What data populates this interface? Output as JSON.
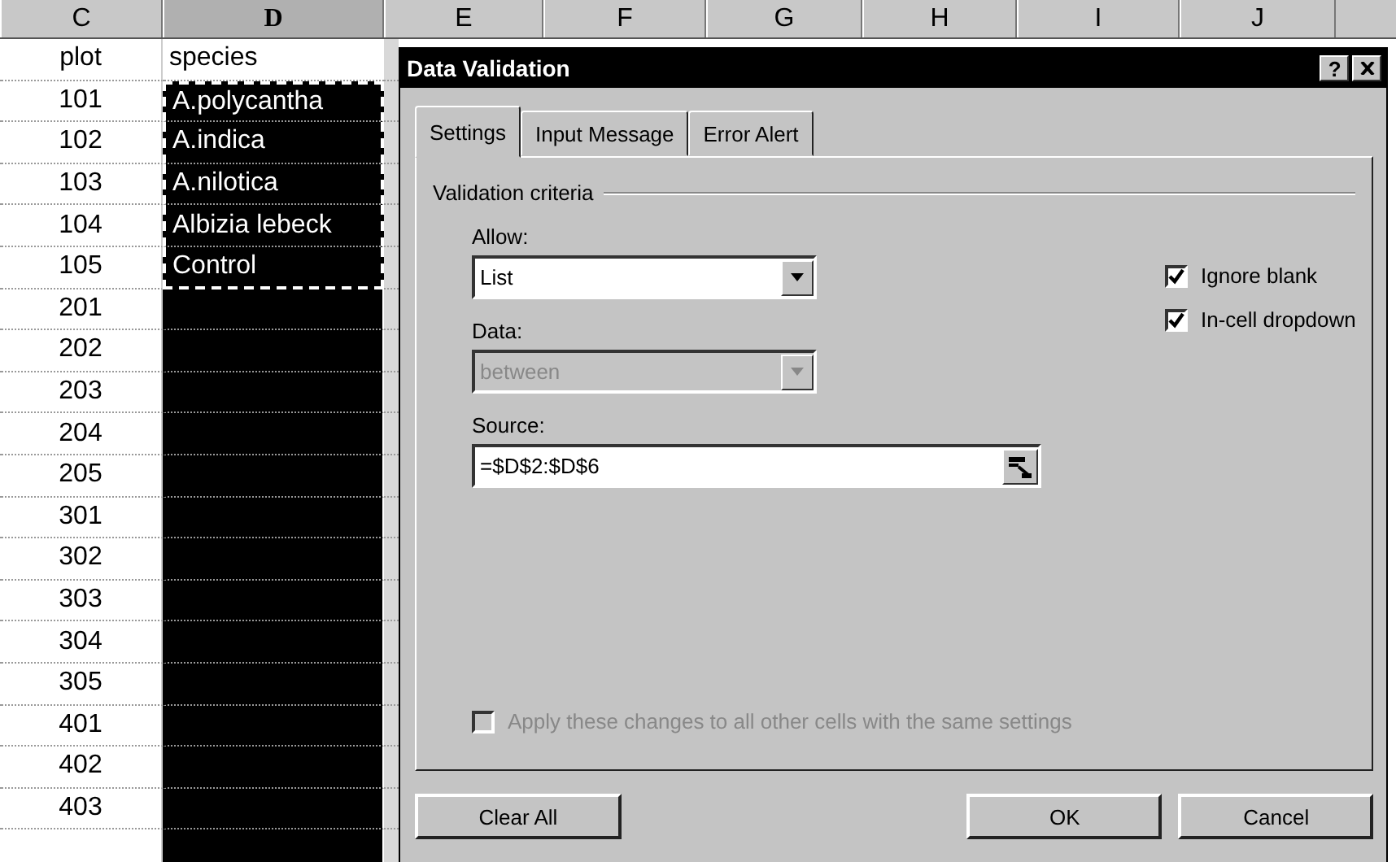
{
  "columns": [
    {
      "label": "C",
      "selected": false
    },
    {
      "label": "D",
      "selected": true
    },
    {
      "label": "E",
      "selected": false
    },
    {
      "label": "F",
      "selected": false
    },
    {
      "label": "G",
      "selected": false
    },
    {
      "label": "H",
      "selected": false
    },
    {
      "label": "I",
      "selected": false
    },
    {
      "label": "J",
      "selected": false
    }
  ],
  "rows": [
    {
      "plot": "plot",
      "species": "species",
      "selected": false,
      "marquee": false
    },
    {
      "plot": "101",
      "species": "A.polycantha",
      "selected": true,
      "marquee": true
    },
    {
      "plot": "102",
      "species": "A.indica",
      "selected": true,
      "marquee": true
    },
    {
      "plot": "103",
      "species": "A.nilotica",
      "selected": true,
      "marquee": true
    },
    {
      "plot": "104",
      "species": "Albizia lebeck",
      "selected": true,
      "marquee": true
    },
    {
      "plot": "105",
      "species": "Control",
      "selected": true,
      "marquee": true
    },
    {
      "plot": "201",
      "selected": true,
      "marquee": false
    },
    {
      "plot": "202",
      "selected": true,
      "marquee": false
    },
    {
      "plot": "203",
      "selected": true,
      "marquee": false
    },
    {
      "plot": "204",
      "selected": true,
      "marquee": false
    },
    {
      "plot": "205",
      "selected": true,
      "marquee": false
    },
    {
      "plot": "301",
      "selected": true,
      "marquee": false
    },
    {
      "plot": "302",
      "selected": true,
      "marquee": false
    },
    {
      "plot": "303",
      "selected": true,
      "marquee": false
    },
    {
      "plot": "304",
      "selected": true,
      "marquee": false
    },
    {
      "plot": "305",
      "selected": true,
      "marquee": false
    },
    {
      "plot": "401",
      "selected": true,
      "marquee": false
    },
    {
      "plot": "402",
      "selected": true,
      "marquee": false
    },
    {
      "plot": "403",
      "selected": true,
      "marquee": false
    }
  ],
  "dialog": {
    "title": "Data Validation",
    "help_button": "?",
    "tabs": [
      {
        "label": "Settings",
        "selected": true
      },
      {
        "label": "Input Message",
        "selected": false
      },
      {
        "label": "Error Alert",
        "selected": false
      }
    ],
    "group_label": "Validation criteria",
    "allow": {
      "label": "Allow:",
      "value": "List",
      "disabled": false
    },
    "data": {
      "label": "Data:",
      "value": "between",
      "disabled": true
    },
    "source": {
      "label": "Source:",
      "value": "=$D$2:$D$6"
    },
    "options": [
      {
        "label": "Ignore blank",
        "checked": true,
        "disabled": false
      },
      {
        "label": "In-cell dropdown",
        "checked": true,
        "disabled": false
      }
    ],
    "apply_option": {
      "label": "Apply these changes to all other cells with the same settings",
      "checked": false,
      "disabled": true
    },
    "buttons": [
      {
        "label": "Clear All",
        "kind": "left"
      },
      {
        "label": "OK",
        "kind": "right"
      },
      {
        "label": "Cancel",
        "kind": "right"
      }
    ]
  }
}
